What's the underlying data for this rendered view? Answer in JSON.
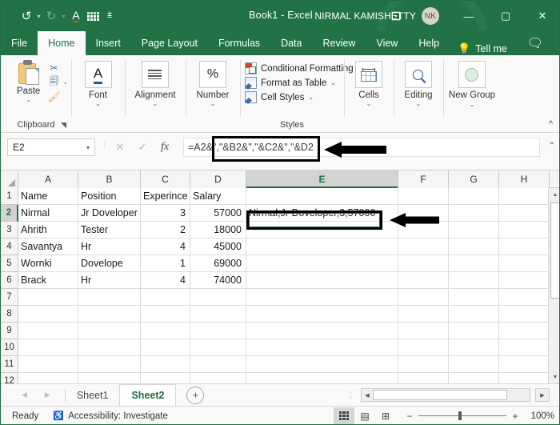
{
  "titlebar": {
    "quick_access": [
      {
        "name": "undo-icon",
        "glyph": "↺"
      },
      {
        "name": "redo-icon",
        "glyph": "↻"
      },
      {
        "name": "font-color-icon",
        "glyph": "A"
      },
      {
        "name": "borders-icon",
        "glyph": "▦"
      },
      {
        "name": "customize-qat-icon",
        "glyph": "▾"
      }
    ],
    "document_title": "Book1  -  Excel",
    "account_name": "NIRMAL KAMISHETTY",
    "avatar_initials": "NK",
    "ribbon_display_options": "⊡",
    "minimize": "—",
    "maximize": "▢",
    "close": "✕"
  },
  "ribbon_tabs": [
    {
      "label": "File",
      "active": false
    },
    {
      "label": "Home",
      "active": true
    },
    {
      "label": "Insert",
      "active": false
    },
    {
      "label": "Page Layout",
      "active": false
    },
    {
      "label": "Formulas",
      "active": false
    },
    {
      "label": "Data",
      "active": false
    },
    {
      "label": "Review",
      "active": false
    },
    {
      "label": "View",
      "active": false
    },
    {
      "label": "Help",
      "active": false
    }
  ],
  "tell_me": {
    "label": "Tell me",
    "icon": "lightbulb-icon"
  },
  "comment_button": "comment-icon",
  "ribbon": {
    "clipboard": {
      "paste_label": "Paste",
      "group_label": "Clipboard",
      "items": [
        "cut-icon",
        "copy-icon",
        "format-painter-icon"
      ]
    },
    "font": {
      "label": "Font"
    },
    "alignment": {
      "label": "Alignment"
    },
    "number": {
      "label": "Number",
      "glyph": "%"
    },
    "styles": {
      "group_label": "Styles",
      "items": [
        {
          "label": "Conditional Formatting",
          "icon": "conditional-formatting-icon"
        },
        {
          "label": "Format as Table",
          "icon": "format-as-table-icon"
        },
        {
          "label": "Cell Styles",
          "icon": "cell-styles-icon"
        }
      ]
    },
    "cells": {
      "label": "Cells"
    },
    "editing": {
      "label": "Editing"
    },
    "new_group": {
      "label": "New Group"
    },
    "collapse_ribbon": "^"
  },
  "formula_bar": {
    "name_box_value": "E2",
    "cancel_icon": "✕",
    "enter_icon": "✓",
    "function_icon": "fx",
    "formula": "=A2&\",\"&B2&\",\"&C2&\",\"&D2",
    "expand_icon": "⌃"
  },
  "grid": {
    "column_headers": [
      "A",
      "B",
      "C",
      "D",
      "E",
      "F",
      "G",
      "H"
    ],
    "selected_column": "E",
    "row_headers": [
      "1",
      "2",
      "3",
      "4",
      "5",
      "6",
      "7",
      "8",
      "9",
      "10",
      "11",
      "12"
    ],
    "selected_row": "2",
    "rows": [
      {
        "A": "Name",
        "B": "Position",
        "C": "Experince",
        "D": "Salary",
        "E": "",
        "F": "",
        "G": "",
        "H": ""
      },
      {
        "A": "Nirmal",
        "B": "Jr Doveloper",
        "C": "3",
        "D": "57000",
        "E": "Nirmal,Jr Doveloper,3,57000",
        "F": "",
        "G": "",
        "H": ""
      },
      {
        "A": "Ahrith",
        "B": "Tester",
        "C": "2",
        "D": "18000",
        "E": "",
        "F": "",
        "G": "",
        "H": ""
      },
      {
        "A": "Savantya",
        "B": "Hr",
        "C": "4",
        "D": "45000",
        "E": "",
        "F": "",
        "G": "",
        "H": ""
      },
      {
        "A": "Wornki",
        "B": "Dovelope",
        "C": "1",
        "D": "69000",
        "E": "",
        "F": "",
        "G": "",
        "H": ""
      },
      {
        "A": "Brack",
        "B": "Hr",
        "C": "4",
        "D": "74000",
        "E": "",
        "F": "",
        "G": "",
        "H": ""
      },
      {
        "A": "",
        "B": "",
        "C": "",
        "D": "",
        "E": "",
        "F": "",
        "G": "",
        "H": ""
      },
      {
        "A": "",
        "B": "",
        "C": "",
        "D": "",
        "E": "",
        "F": "",
        "G": "",
        "H": ""
      },
      {
        "A": "",
        "B": "",
        "C": "",
        "D": "",
        "E": "",
        "F": "",
        "G": "",
        "H": ""
      },
      {
        "A": "",
        "B": "",
        "C": "",
        "D": "",
        "E": "",
        "F": "",
        "G": "",
        "H": ""
      },
      {
        "A": "",
        "B": "",
        "C": "",
        "D": "",
        "E": "",
        "F": "",
        "G": "",
        "H": ""
      },
      {
        "A": "",
        "B": "",
        "C": "",
        "D": "",
        "E": "",
        "F": "",
        "G": "",
        "H": ""
      }
    ],
    "numeric_columns": [
      "C",
      "D"
    ]
  },
  "annotations": {
    "formula_highlight": "black-rectangle-around-formula",
    "formula_arrow": "left-pointing-arrow",
    "cell_highlight": "black-rectangle-around-cell-E2",
    "cell_arrow": "left-pointing-arrow"
  },
  "sheet_tabs": {
    "prev_icon": "◀",
    "next_icon": "▶",
    "tabs": [
      {
        "label": "Sheet1",
        "active": false
      },
      {
        "label": "Sheet2",
        "active": true
      }
    ],
    "add_sheet": "+"
  },
  "status_bar": {
    "ready_text": "Ready",
    "accessibility_text": "Accessibility: Investigate",
    "views": [
      {
        "name": "normal-view-button",
        "active": true
      },
      {
        "name": "page-layout-view-button",
        "active": false
      },
      {
        "name": "page-break-preview-button",
        "active": false
      }
    ],
    "zoom_out": "−",
    "zoom_in": "+",
    "zoom_level": "100%"
  },
  "colors": {
    "excel_green": "#217346",
    "tab_active_bg": "#f9f9f9",
    "accent_text": "#1d6f45",
    "grid_line": "#dcdcdc",
    "header_bg": "#f5f5f5"
  }
}
